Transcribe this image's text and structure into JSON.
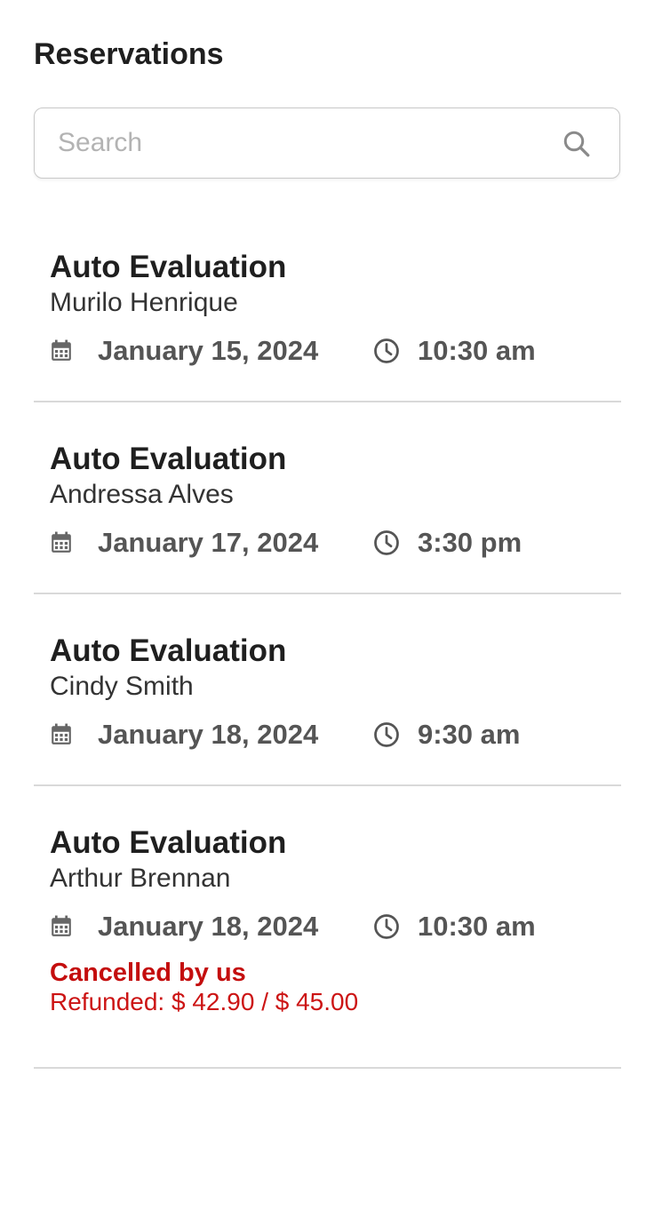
{
  "header": {
    "title": "Reservations"
  },
  "search": {
    "placeholder": "Search",
    "value": ""
  },
  "colors": {
    "accent_cancel": "#c40e0e",
    "divider": "#d9d9d9",
    "meta_text": "#555555"
  },
  "icons": {
    "search": "search-icon",
    "date": "calendar-icon",
    "time": "clock-icon"
  },
  "reservations": [
    {
      "title": "Auto Evaluation",
      "customer": "Murilo Henrique",
      "date": "January 15, 2024",
      "time": "10:30 am"
    },
    {
      "title": "Auto Evaluation",
      "customer": "Andressa Alves",
      "date": "January 17, 2024",
      "time": "3:30 pm"
    },
    {
      "title": "Auto Evaluation",
      "customer": "Cindy Smith",
      "date": "January 18, 2024",
      "time": "9:30 am"
    },
    {
      "title": "Auto Evaluation",
      "customer": "Arthur Brennan",
      "date": "January 18, 2024",
      "time": "10:30 am",
      "status": "Cancelled by us",
      "refund": "Refunded: $ 42.90 / $ 45.00"
    }
  ]
}
